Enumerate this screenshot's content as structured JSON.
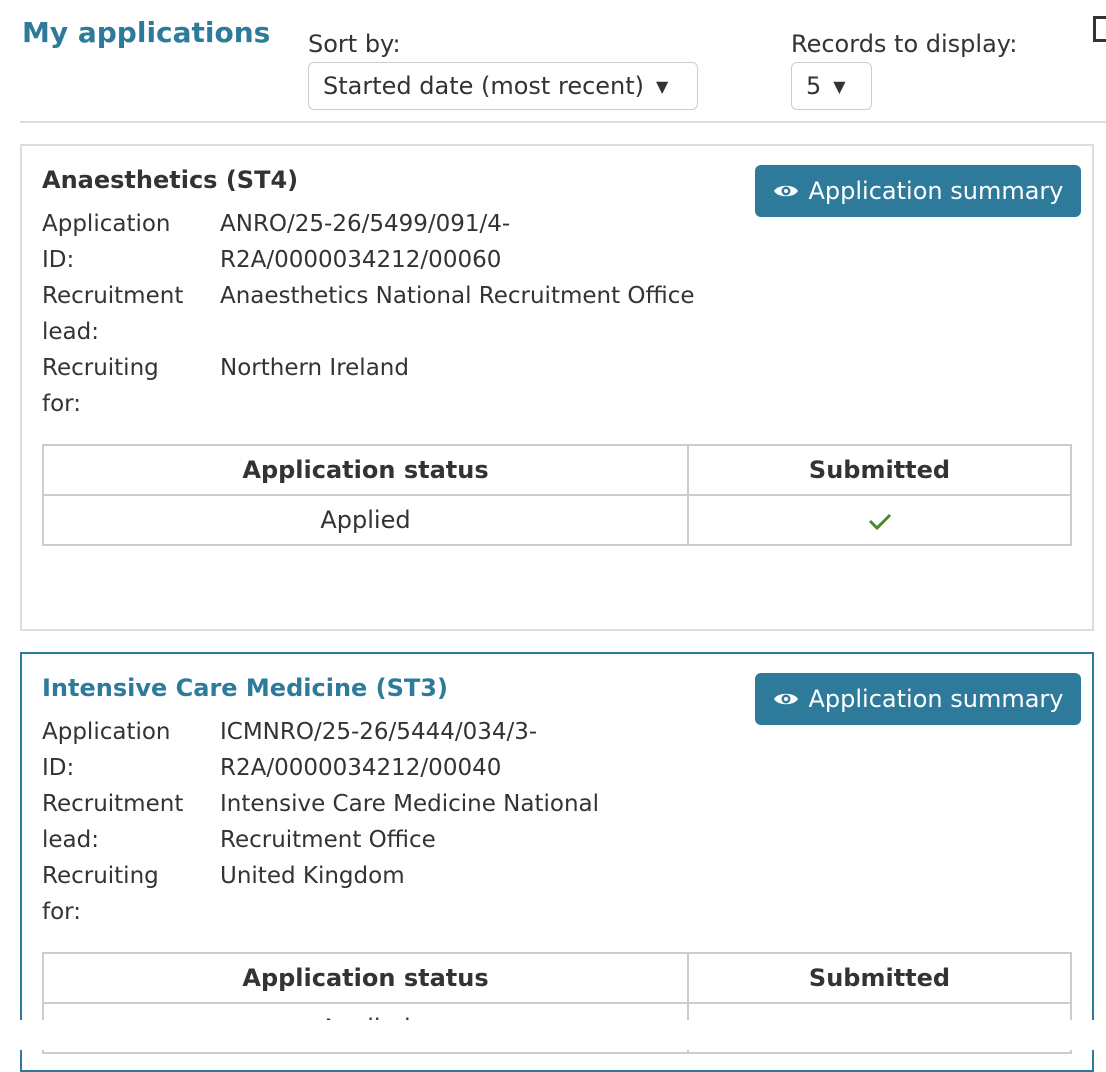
{
  "header": {
    "title": "My applications",
    "sort_label": "Sort by:",
    "sort_value": "Started date (most recent)",
    "records_label": "Records to display:",
    "records_value": "5"
  },
  "applications": [
    {
      "title": "Anaesthetics (ST4)",
      "summary_button": "Application summary",
      "fields": [
        {
          "label_line1": "Application",
          "label_line2": "ID:",
          "value_line1": "ANRO/25-26/5499/091/4-",
          "value_line2": "R2A/0000034212/00060"
        },
        {
          "label_line1": "Recruitment",
          "label_line2": "lead:",
          "value_line1": "Anaesthetics National Recruitment Office",
          "value_line2": ""
        },
        {
          "label_line1": "Recruiting",
          "label_line2": "for:",
          "value_line1": "Northern Ireland",
          "value_line2": ""
        }
      ],
      "table_headers": [
        "Application status",
        "Submitted"
      ],
      "status": "Applied",
      "submitted_icon": "check-icon"
    },
    {
      "title": "Intensive Care Medicine (ST3)",
      "summary_button": "Application summary",
      "fields": [
        {
          "label_line1": "Application",
          "label_line2": "ID:",
          "value_line1": "ICMNRO/25-26/5444/034/3-",
          "value_line2": "R2A/0000034212/00040"
        },
        {
          "label_line1": "Recruitment",
          "label_line2": "lead:",
          "value_line1": "Intensive Care Medicine National",
          "value_line2": "Recruitment Office"
        },
        {
          "label_line1": "Recruiting",
          "label_line2": "for:",
          "value_line1": "United Kingdom",
          "value_line2": ""
        }
      ],
      "table_headers": [
        "Application status",
        "Submitted"
      ],
      "status": "Applied",
      "submitted_icon": "check-icon"
    }
  ],
  "colors": {
    "accent": "#2d7a9b",
    "check": "#4a8a2a",
    "border": "#dddddd"
  }
}
